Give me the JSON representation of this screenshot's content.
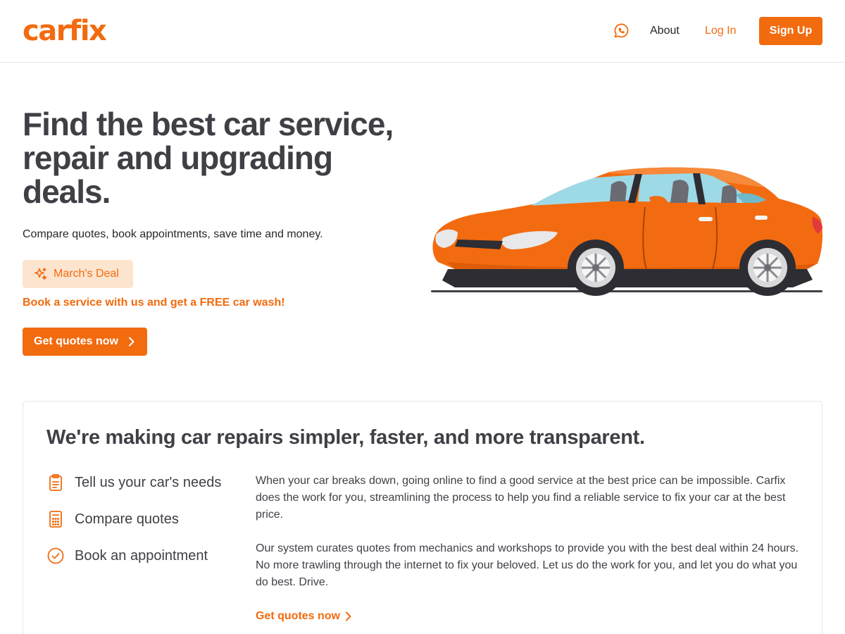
{
  "header": {
    "logo_text": "carfix",
    "whatsapp_icon": "whatsapp-icon",
    "nav_about": "About",
    "nav_login": "Log In",
    "signup_label": "Sign Up"
  },
  "hero": {
    "title": "Find the best car service, repair and upgrading deals.",
    "subtitle": "Compare quotes, book appointments, save time and money.",
    "deal_badge": "March's Deal",
    "deal_icon": "sparkles-icon",
    "deal_text": "Book a service with us and get a FREE car wash!",
    "cta_label": "Get quotes now",
    "cta_icon": "chevron-right-icon"
  },
  "info": {
    "title": "We're making car repairs simpler, faster, and more transparent.",
    "steps": [
      {
        "label": "Tell us your car's needs",
        "icon": "clipboard-list-icon"
      },
      {
        "label": "Compare quotes",
        "icon": "calculator-icon"
      },
      {
        "label": "Book an appointment",
        "icon": "check-circle-icon"
      }
    ],
    "paragraph_1": "When your car breaks down, going online to find a good service at the best price can be impossible. Carfix does the work for you, streamlining the process to help you find a reliable service to fix your car at the best price.",
    "paragraph_2": "Our system curates quotes from mechanics and workshops to provide you with the best deal within 24 hours. No more trawling through the internet to fix your beloved. Let us do the work for you, and let you do what you do best. Drive.",
    "link_label": "Get quotes now"
  },
  "colors": {
    "brand_orange": "#f26b0f",
    "badge_bg": "#fde4cf",
    "text_dark": "#3f3f46",
    "border": "#e5e7eb"
  }
}
